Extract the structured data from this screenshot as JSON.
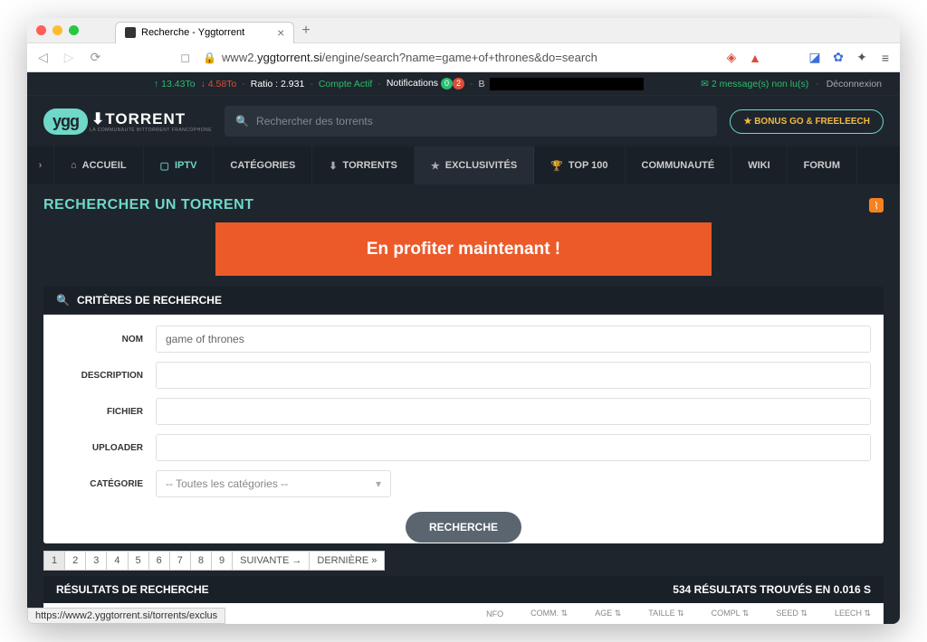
{
  "browser": {
    "tab_title": "Recherche - Yggtorrent",
    "url_prefix": "www2.",
    "url_domain": "yggtorrent.si",
    "url_path": "/engine/search?name=game+of+thrones&do=search",
    "status_link": "https://www2.yggtorrent.si/torrents/exclus"
  },
  "stats": {
    "up": "13.43To",
    "down": "4.58To",
    "ratio_label": "Ratio :",
    "ratio_value": "2.931",
    "account": "Compte Actif",
    "notifications": "Notifications",
    "notif_count1": "0",
    "notif_count2": "2",
    "messages": "2 message(s) non lu(s)",
    "logout": "Déconnexion"
  },
  "header": {
    "logo_badge": "ygg",
    "logo_text": "TORRENT",
    "logo_sub": "LA COMMUNAUTÉ BITTORRENT FRANCOPHONE",
    "search_placeholder": "Rechercher des torrents",
    "bonus": "★ BONUS GO & FREELEECH"
  },
  "nav": {
    "items": [
      {
        "icon": "⌂",
        "label": "ACCUEIL"
      },
      {
        "icon": "▢",
        "label": "IPTV"
      },
      {
        "icon": "",
        "label": "CATÉGORIES"
      },
      {
        "icon": "⬇",
        "label": "TORRENTS"
      },
      {
        "icon": "★",
        "label": "EXCLUSIVITÉS"
      },
      {
        "icon": "🏆",
        "label": "TOP 100"
      },
      {
        "icon": "",
        "label": "COMMUNAUTÉ"
      },
      {
        "icon": "",
        "label": "WIKI"
      },
      {
        "icon": "",
        "label": "FORUM"
      }
    ]
  },
  "page": {
    "title": "RECHERCHER UN TORRENT",
    "banner": "En profiter maintenant !"
  },
  "criteria": {
    "heading": "CRITÈRES DE RECHERCHE",
    "fields": {
      "nom_label": "NOM",
      "nom_value": "game of thrones",
      "desc_label": "DESCRIPTION",
      "fichier_label": "FICHIER",
      "uploader_label": "UPLOADER",
      "categorie_label": "CATÉGORIE",
      "categorie_value": "-- Toutes les catégories --"
    },
    "submit": "RECHERCHE"
  },
  "pagination": {
    "pages": [
      "1",
      "2",
      "3",
      "4",
      "5",
      "6",
      "7",
      "8",
      "9"
    ],
    "next": "SUIVANTE →",
    "last": "DERNIÈRE »"
  },
  "results": {
    "heading": "RÉSULTATS DE RECHERCHE",
    "summary": "534 RÉSULTATS TROUVÉS EN 0.016 S",
    "columns": [
      "NFO",
      "COMM. ⇅",
      "AGE ⇅",
      "TAILLE ⇅",
      "COMPL ⇅",
      "SEED ⇅",
      "LEECH ⇅"
    ]
  }
}
